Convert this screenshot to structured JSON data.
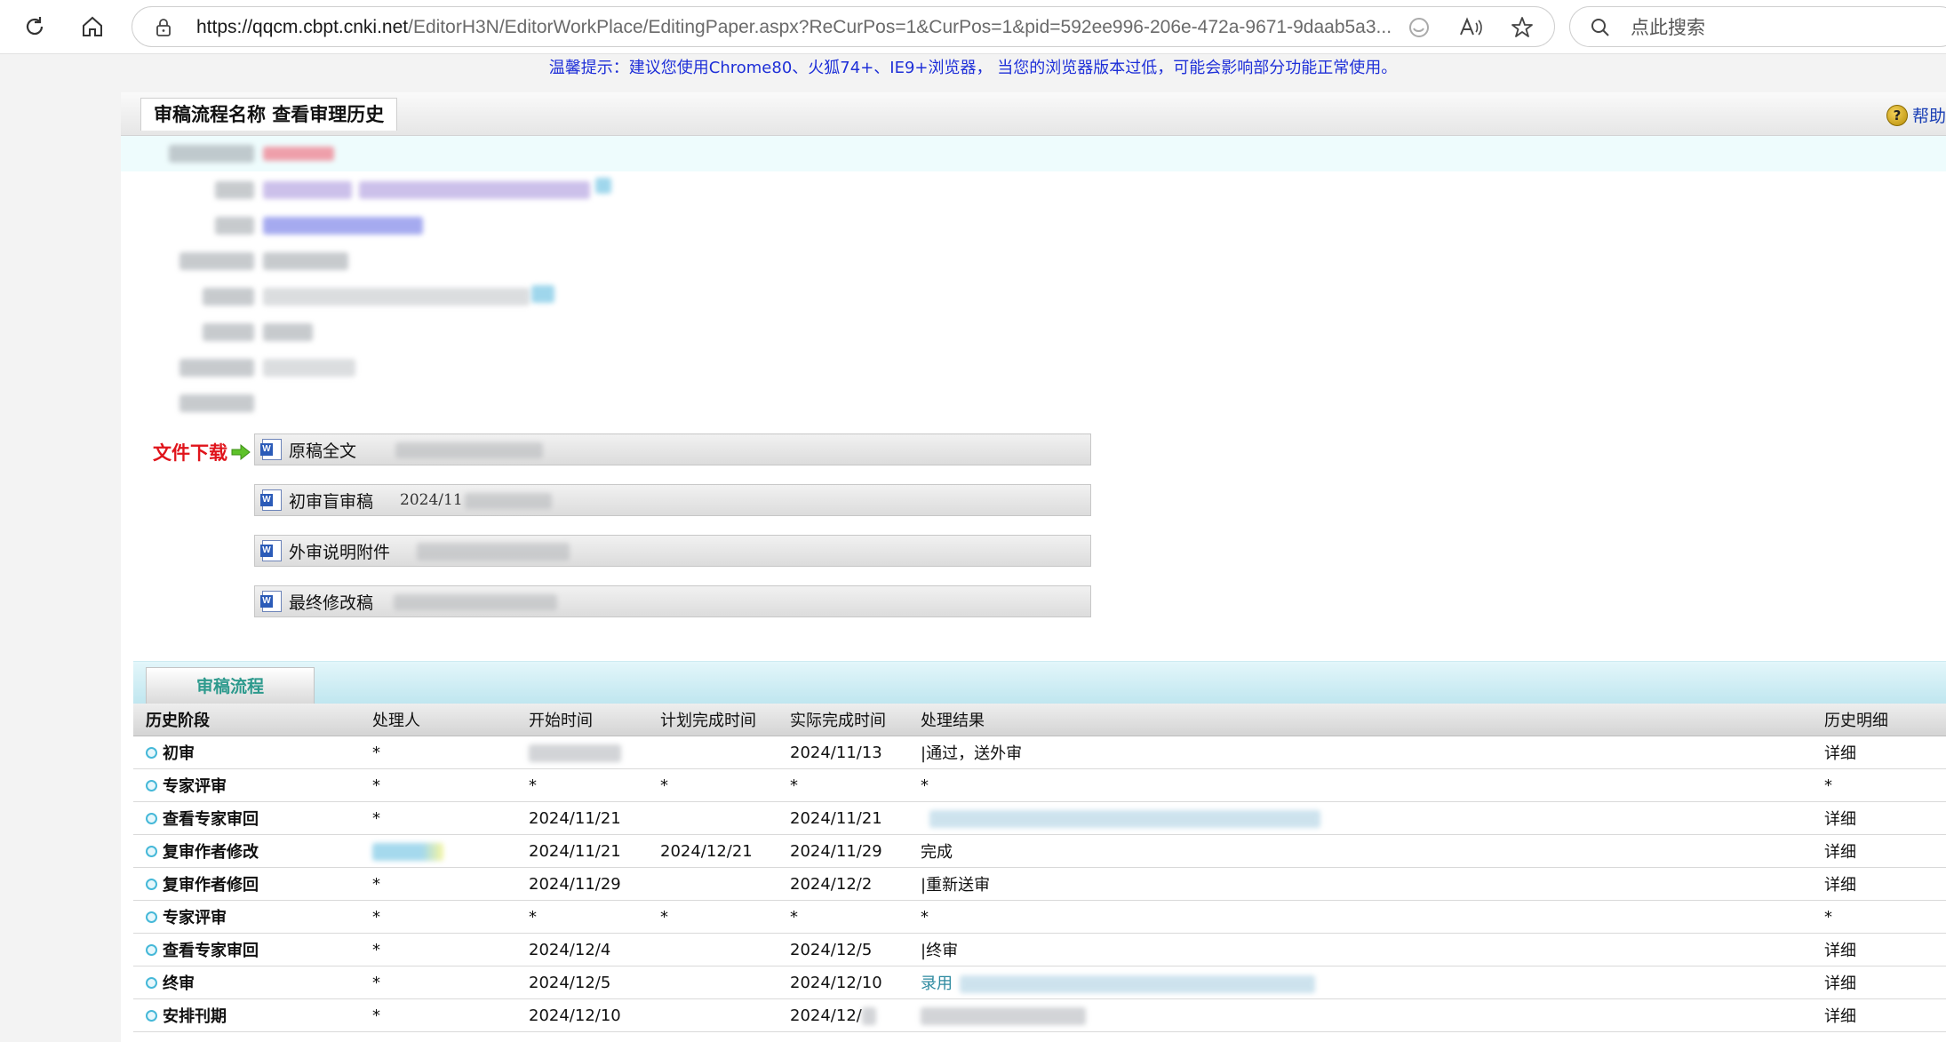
{
  "browser": {
    "url_host": "https://qqcm.cbpt.cnki.net",
    "url_path": "/EditorH3N/EditorWorkPlace/EditingPaper.aspx?ReCurPos=1&CurPos=1&pid=592ee996-206e-472a-9671-9daab5a3...",
    "search_placeholder": "点此搜索"
  },
  "warning": "温馨提示：建议您使用Chrome80、火狐74+、IE9+浏览器， 当您的浏览器版本过低，可能会影响部分功能正常使用。",
  "panel": {
    "title": "审稿流程名称 查看审理历史",
    "help": "帮助"
  },
  "files": {
    "label": "文件下载",
    "items": [
      {
        "name": "原稿全文",
        "date": ""
      },
      {
        "name": "初审盲审稿",
        "date": "2024/11"
      },
      {
        "name": "外审说明附件",
        "date": ""
      },
      {
        "name": "最终修改稿",
        "date": ""
      }
    ]
  },
  "process": {
    "tab": "审稿流程",
    "columns": [
      "历史阶段",
      "处理人",
      "开始时间",
      "计划完成时间",
      "实际完成时间",
      "处理结果",
      "历史明细"
    ],
    "rows": [
      {
        "stage": "初审",
        "handler": "*",
        "start": "",
        "planned": "",
        "actual": "2024/11/13",
        "result": "|通过，送外审",
        "detail": "详细"
      },
      {
        "stage": "专家评审",
        "handler": "*",
        "start": "*",
        "planned": "*",
        "actual": "*",
        "result": "*",
        "detail": "*"
      },
      {
        "stage": "查看专家审回",
        "handler": "*",
        "start": "2024/11/21",
        "planned": "",
        "actual": "2024/11/21",
        "result": "",
        "detail": "详细"
      },
      {
        "stage": "复审作者修改",
        "handler": "",
        "start": "2024/11/21",
        "planned": "2024/12/21",
        "actual": "2024/11/29",
        "result": "完成",
        "detail": "详细"
      },
      {
        "stage": "复审作者修回",
        "handler": "*",
        "start": "2024/11/29",
        "planned": "",
        "actual": "2024/12/2",
        "result": "|重新送审",
        "detail": "详细"
      },
      {
        "stage": "专家评审",
        "handler": "*",
        "start": "*",
        "planned": "*",
        "actual": "*",
        "result": "*",
        "detail": "*"
      },
      {
        "stage": "查看专家审回",
        "handler": "*",
        "start": "2024/12/4",
        "planned": "",
        "actual": "2024/12/5",
        "result": "|终审",
        "detail": "详细"
      },
      {
        "stage": "终审",
        "handler": "*",
        "start": "2024/12/5",
        "planned": "",
        "actual": "2024/12/10",
        "result": "录用",
        "detail": "详细"
      },
      {
        "stage": "安排刊期",
        "handler": "*",
        "start": "2024/12/10",
        "planned": "",
        "actual": "2024/12/",
        "result": "",
        "detail": "详细"
      }
    ]
  },
  "colors": {
    "warning_text": "#1e2fd8",
    "file_label": "#e0141b",
    "link": "#1b33c4",
    "tab_text": "#2d9a8d"
  }
}
